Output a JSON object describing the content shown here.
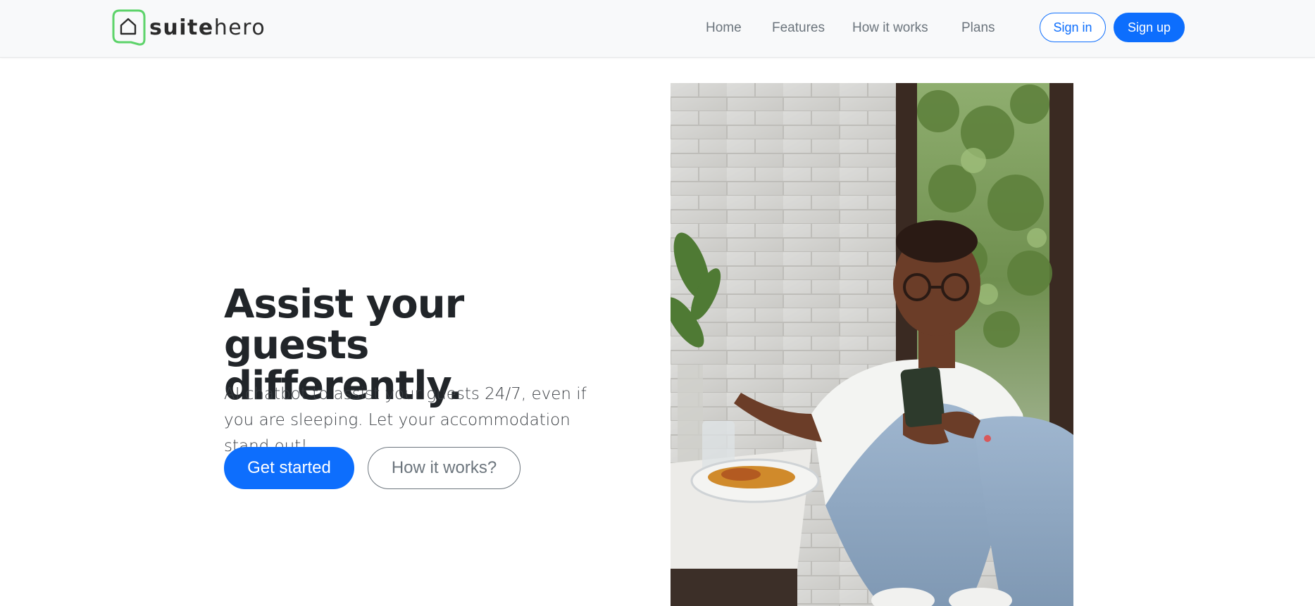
{
  "brand": {
    "name_bold": "suite",
    "name_regular": "hero",
    "logo_icon": "house-chat-bubble-icon",
    "logo_color": "#5dd36a"
  },
  "nav": {
    "items": [
      {
        "label": "Home"
      },
      {
        "label": "Features"
      },
      {
        "label": "How it works"
      },
      {
        "label": "Plans"
      }
    ],
    "sign_in": "Sign in",
    "sign_up": "Sign up"
  },
  "hero": {
    "title": "Assist your guests differently.",
    "subtitle": "AI chatbot to assist your guests 24/7, even if you are sleeping. Let your accommodation stand out!",
    "primary_button": "Get started",
    "secondary_button": "How it works?",
    "image_description_icon": "woman-with-phone-photo"
  },
  "colors": {
    "accent": "#0d6efd",
    "text_dark": "#212529",
    "text_muted": "#6c757d",
    "navbar_bg": "#f8f9fa"
  }
}
